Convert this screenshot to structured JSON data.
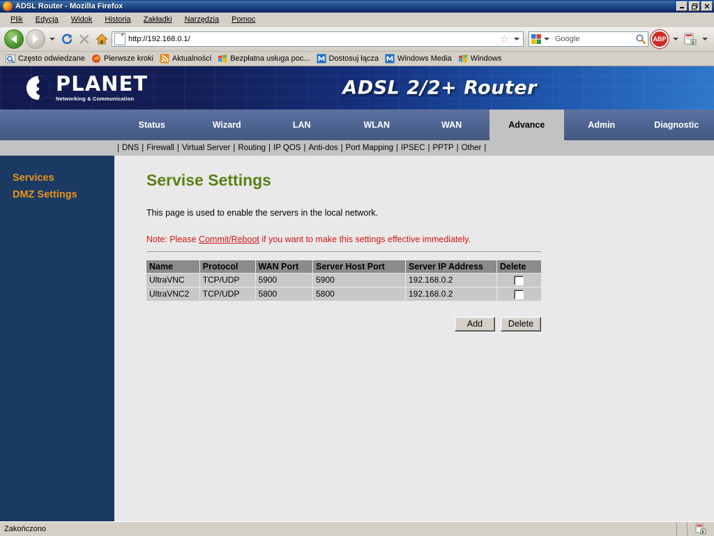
{
  "window": {
    "title": "ADSL Router - Mozilla Firefox",
    "minimize_label": "_",
    "restore_label": "❐",
    "close_label": "✕"
  },
  "menu": {
    "items": [
      {
        "label": "Plik"
      },
      {
        "label": "Edycja"
      },
      {
        "label": "Widok"
      },
      {
        "label": "Historia"
      },
      {
        "label": "Zakładki"
      },
      {
        "label": "Narzędzia"
      },
      {
        "label": "Pomoc"
      }
    ]
  },
  "toolbar": {
    "url": "http://192.168.0.1/",
    "search_value": "Google",
    "abp_label": "ABP"
  },
  "bookmarks": {
    "items": [
      {
        "label": "Często odwiedzane",
        "icon": "history-icon"
      },
      {
        "label": "Pierwsze kroki",
        "icon": "firefox-icon"
      },
      {
        "label": "Aktualności",
        "icon": "rss-icon"
      },
      {
        "label": "Bezpłatna usługa poc...",
        "icon": "windows-icon"
      },
      {
        "label": "Dostosuj łącza",
        "icon": "msn-icon"
      },
      {
        "label": "Windows Media",
        "icon": "msn-icon"
      },
      {
        "label": "Windows",
        "icon": "windows-icon"
      }
    ]
  },
  "banner": {
    "logo_name": "PLANET",
    "logo_tagline": "Networking & Communication",
    "product_title": "ADSL 2/2+ Router"
  },
  "nav": {
    "tabs": [
      {
        "label": "Status",
        "active": false
      },
      {
        "label": "Wizard",
        "active": false
      },
      {
        "label": "LAN",
        "active": false
      },
      {
        "label": "WLAN",
        "active": false
      },
      {
        "label": "WAN",
        "active": false
      },
      {
        "label": "Advance",
        "active": true
      },
      {
        "label": "Admin",
        "active": false
      },
      {
        "label": "Diagnostic",
        "active": false
      }
    ]
  },
  "submenu": {
    "items": [
      {
        "label": "DNS"
      },
      {
        "label": "Firewall"
      },
      {
        "label": "Virtual Server"
      },
      {
        "label": "Routing"
      },
      {
        "label": "IP QOS"
      },
      {
        "label": "Anti-dos"
      },
      {
        "label": "Port Mapping"
      },
      {
        "label": "IPSEC"
      },
      {
        "label": "PPTP"
      },
      {
        "label": "Other"
      }
    ]
  },
  "sidebar": {
    "items": [
      {
        "label": "Services"
      },
      {
        "label": "DMZ Settings"
      }
    ]
  },
  "main": {
    "heading": "Servise Settings",
    "description": "This page is used to enable the servers in the local network.",
    "note_prefix": "Note: Please ",
    "note_link": "Commit/Reboot",
    "note_suffix": " if you want to make this settings effective immediately.",
    "table": {
      "columns": [
        "Name",
        "Protocol",
        "WAN Port",
        "Server Host Port",
        "Server IP Address",
        "Delete"
      ],
      "rows": [
        {
          "name": "UltraVNC",
          "protocol": "TCP/UDP",
          "wan_port": "5900",
          "server_host_port": "5900",
          "server_ip": "192.168.0.2",
          "delete_checked": false
        },
        {
          "name": "UltraVNC2",
          "protocol": "TCP/UDP",
          "wan_port": "5800",
          "server_host_port": "5800",
          "server_ip": "192.168.0.2",
          "delete_checked": false
        }
      ]
    },
    "buttons": {
      "add_label": "Add",
      "delete_label": "Delete"
    }
  },
  "statusbar": {
    "text": "Zakończono"
  },
  "colors": {
    "titlebar_blue": "#0a246a",
    "banner_navy": "#121a4d",
    "banner_blue": "#2f78c9",
    "navtab_blue": "#4e6593",
    "active_tab_gray": "#c2c2c2",
    "sidebar_navy": "#1b3a63",
    "sidebar_orange": "#e8941a",
    "heading_green": "#5a7f14",
    "note_red": "#d01717",
    "table_header_gray": "#8b8b8b",
    "table_cell_gray": "#c8c8c8",
    "page_bg": "#e9e9e9",
    "chrome_gray": "#d4d0c8"
  }
}
